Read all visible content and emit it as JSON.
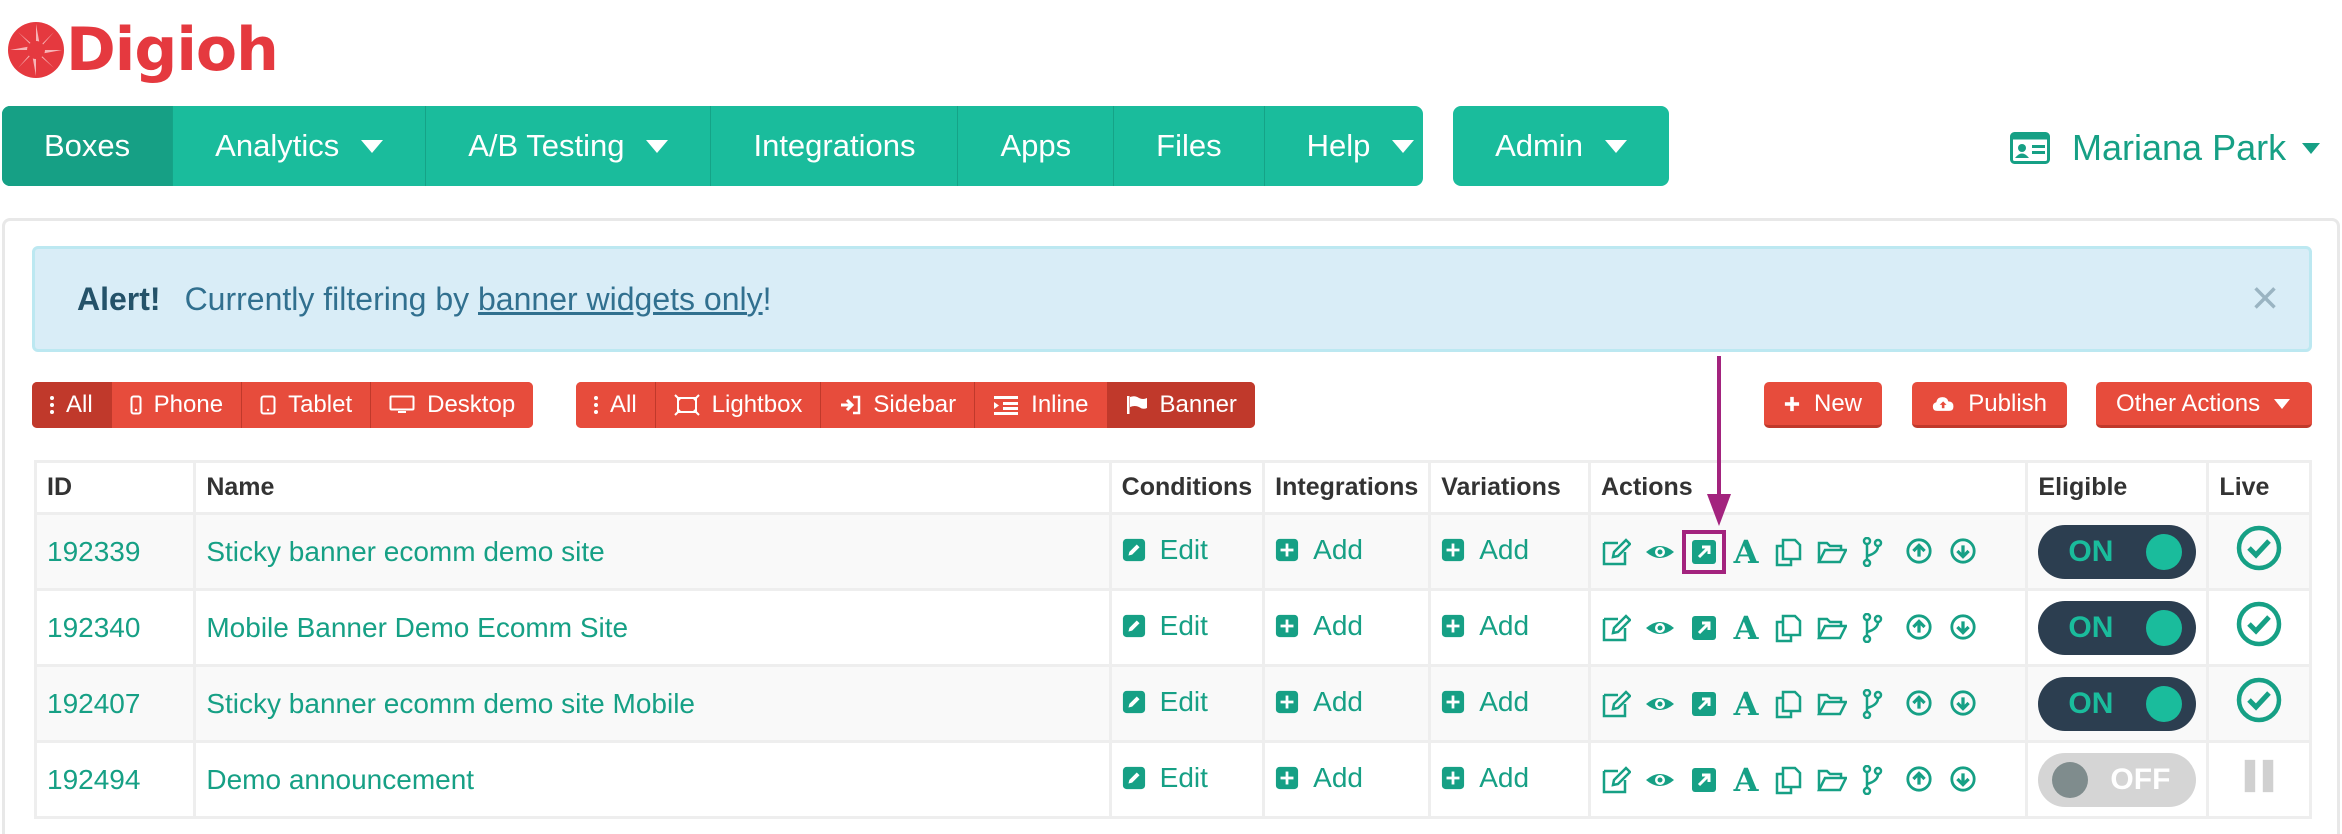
{
  "app": {
    "logo_text": "Digioh"
  },
  "nav": {
    "items": [
      {
        "label": "Boxes",
        "active": true,
        "dropdown": false
      },
      {
        "label": "Analytics",
        "dropdown": true
      },
      {
        "label": "A/B Testing",
        "dropdown": true
      },
      {
        "label": "Integrations",
        "dropdown": false
      },
      {
        "label": "Apps",
        "dropdown": false
      },
      {
        "label": "Files",
        "dropdown": false
      },
      {
        "label": "Help",
        "dropdown": true
      }
    ],
    "admin_label": "Admin"
  },
  "user": {
    "name": "Mariana Park",
    "icon": "id-card-icon"
  },
  "alert": {
    "title": "Alert!",
    "text_before": "Currently filtering by",
    "link_text": "banner widgets only",
    "text_after": "!",
    "close": "×"
  },
  "device_filters": [
    {
      "label": "All",
      "icon": "more-vertical-icon",
      "active": true
    },
    {
      "label": "Phone",
      "icon": "phone-icon"
    },
    {
      "label": "Tablet",
      "icon": "tablet-icon"
    },
    {
      "label": "Desktop",
      "icon": "desktop-icon"
    }
  ],
  "type_filters": [
    {
      "label": "All",
      "icon": "more-vertical-icon"
    },
    {
      "label": "Lightbox",
      "icon": "lightbox-icon"
    },
    {
      "label": "Sidebar",
      "icon": "sign-in-icon"
    },
    {
      "label": "Inline",
      "icon": "indent-icon"
    },
    {
      "label": "Banner",
      "icon": "flag-icon",
      "active": true
    }
  ],
  "toolbar": {
    "new_label": "New",
    "publish_label": "Publish",
    "other_label": "Other Actions"
  },
  "table": {
    "headers": {
      "id": "ID",
      "name": "Name",
      "conditions": "Conditions",
      "integrations": "Integrations",
      "variations": "Variations",
      "actions": "Actions",
      "eligible": "Eligible",
      "live": "Live"
    },
    "edit_label": "Edit",
    "add_label": "Add",
    "rows": [
      {
        "id": "192339",
        "name": "Sticky banner ecomm demo site",
        "eligible": "ON",
        "live": "check"
      },
      {
        "id": "192340",
        "name": "Mobile Banner Demo Ecomm Site",
        "eligible": "ON",
        "live": "check"
      },
      {
        "id": "192407",
        "name": "Sticky banner ecomm demo site Mobile",
        "eligible": "ON",
        "live": "check"
      },
      {
        "id": "192494",
        "name": "Demo announcement",
        "eligible": "OFF",
        "live": "pause"
      }
    ],
    "action_icons": [
      "edit-icon",
      "eye-icon",
      "external-link-icon",
      "font-icon",
      "copy-icon",
      "folder-open-icon",
      "code-branch-icon",
      "arrow-circle-up-icon",
      "arrow-circle-down-icon"
    ],
    "font_glyph": "A"
  },
  "colors": {
    "teal": "#1abc9c",
    "red": "#e74c3c",
    "navy": "#2c3e50",
    "annotation": "#a3237e"
  }
}
